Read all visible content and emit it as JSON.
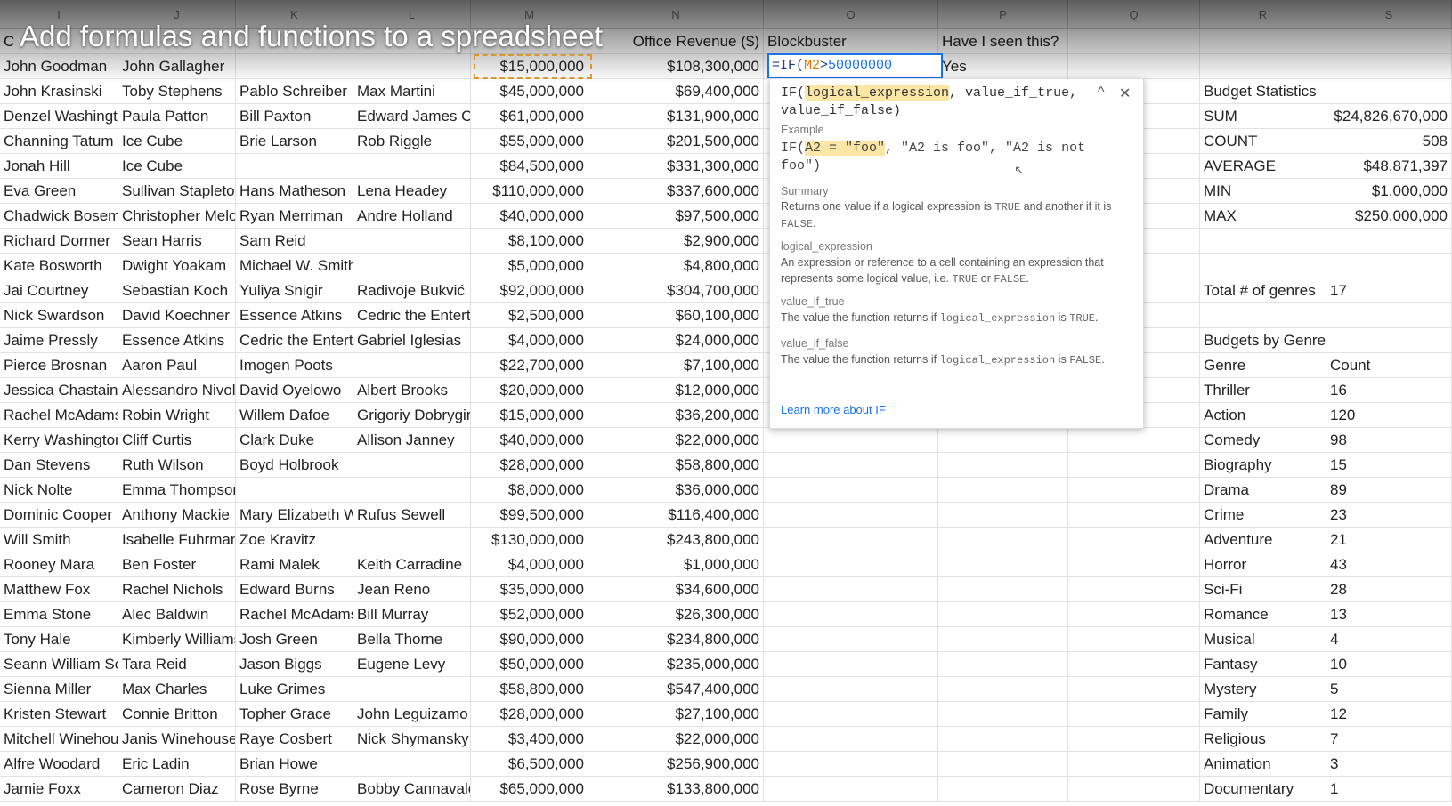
{
  "video_title": "Add formulas and functions to a spreadsheet",
  "column_letters": [
    "I",
    "J",
    "K",
    "L",
    "M",
    "N",
    "O",
    "P",
    "Q",
    "R",
    "S"
  ],
  "header_row": {
    "i": "C",
    "j": "",
    "k": "",
    "l": "",
    "m": "",
    "n": "Office Revenue ($)",
    "o": "Blockbuster",
    "p": "Have I seen this?"
  },
  "active_cell": {
    "formula_prefix": "=IF(",
    "formula_ref": "M2",
    "formula_op": ">",
    "formula_literal": "50000000",
    "p2_value": "Yes"
  },
  "movies": [
    [
      "John Goodman",
      "John Gallagher",
      "",
      "",
      "$15,000,000",
      "$108,300,000"
    ],
    [
      "John Krasinski",
      "Toby Stephens",
      "Pablo Schreiber",
      "Max Martini",
      "$45,000,000",
      "$69,400,000"
    ],
    [
      "Denzel Washingt",
      "Paula Patton",
      "Bill Paxton",
      "Edward James C",
      "$61,000,000",
      "$131,900,000"
    ],
    [
      "Channing Tatum",
      "Ice Cube",
      "Brie Larson",
      "Rob Riggle",
      "$55,000,000",
      "$201,500,000"
    ],
    [
      "Jonah Hill",
      "Ice Cube",
      "",
      "",
      "$84,500,000",
      "$331,300,000"
    ],
    [
      "Eva Green",
      "Sullivan Stapleto",
      "Hans Matheson",
      "Lena Headey",
      "$110,000,000",
      "$337,600,000"
    ],
    [
      "Chadwick Bosem",
      "Christopher Melo",
      "Ryan Merriman",
      "Andre Holland",
      "$40,000,000",
      "$97,500,000"
    ],
    [
      "Richard Dormer",
      "Sean Harris",
      "Sam Reid",
      "",
      "$8,100,000",
      "$2,900,000"
    ],
    [
      "Kate Bosworth",
      "Dwight Yoakam",
      "Michael W. Smith",
      "",
      "$5,000,000",
      "$4,800,000"
    ],
    [
      "Jai Courtney",
      "Sebastian Koch",
      "Yuliya Snigir",
      "Radivoje Bukvić",
      "$92,000,000",
      "$304,700,000"
    ],
    [
      "Nick Swardson",
      "David Koechner",
      "Essence Atkins",
      "Cedric the Entert",
      "$2,500,000",
      "$60,100,000"
    ],
    [
      "Jaime Pressly",
      "Essence Atkins",
      "Cedric the Entert",
      "Gabriel Iglesias",
      "$4,000,000",
      "$24,000,000"
    ],
    [
      "Pierce Brosnan",
      "Aaron Paul",
      "Imogen Poots",
      "",
      "$22,700,000",
      "$7,100,000"
    ],
    [
      "Jessica Chastain",
      "Alessandro Nivol",
      "David Oyelowo",
      "Albert Brooks",
      "$20,000,000",
      "$12,000,000"
    ],
    [
      "Rachel McAdams",
      "Robin Wright",
      "Willem Dafoe",
      "Grigoriy Dobrygir",
      "$15,000,000",
      "$36,200,000"
    ],
    [
      "Kerry Washington",
      "Cliff Curtis",
      "Clark Duke",
      "Allison Janney",
      "$40,000,000",
      "$22,000,000"
    ],
    [
      "Dan Stevens",
      "Ruth Wilson",
      "Boyd Holbrook",
      "",
      "$28,000,000",
      "$58,800,000"
    ],
    [
      "Nick Nolte",
      "Emma Thompson",
      "",
      "",
      "$8,000,000",
      "$36,000,000"
    ],
    [
      "Dominic Cooper",
      "Anthony Mackie",
      "Mary Elizabeth W",
      "Rufus Sewell",
      "$99,500,000",
      "$116,400,000"
    ],
    [
      "Will Smith",
      "Isabelle Fuhrman",
      "Zoe Kravitz",
      "",
      "$130,000,000",
      "$243,800,000"
    ],
    [
      "Rooney Mara",
      "Ben Foster",
      "Rami Malek",
      "Keith Carradine",
      "$4,000,000",
      "$1,000,000"
    ],
    [
      "Matthew Fox",
      "Rachel Nichols",
      "Edward Burns",
      "Jean Reno",
      "$35,000,000",
      "$34,600,000"
    ],
    [
      "Emma Stone",
      "Alec Baldwin",
      "Rachel McAdams",
      "Bill Murray",
      "$52,000,000",
      "$26,300,000"
    ],
    [
      "Tony Hale",
      "Kimberly Williams",
      "Josh Green",
      "Bella Thorne",
      "$90,000,000",
      "$234,800,000"
    ],
    [
      "Seann William Sc",
      "Tara Reid",
      "Jason Biggs",
      "Eugene Levy",
      "$50,000,000",
      "$235,000,000"
    ],
    [
      "Sienna Miller",
      "Max Charles",
      "Luke Grimes",
      "",
      "$58,800,000",
      "$547,400,000"
    ],
    [
      "Kristen Stewart",
      "Connie Britton",
      "Topher Grace",
      "John Leguizamo",
      "$28,000,000",
      "$27,100,000"
    ],
    [
      "Mitchell Winehou",
      "Janis Winehouse",
      "Raye Cosbert",
      "Nick Shymansky",
      "$3,400,000",
      "$22,000,000"
    ],
    [
      "Alfre Woodard",
      "Eric Ladin",
      "Brian Howe",
      "",
      "$6,500,000",
      "$256,900,000"
    ],
    [
      "Jamie Foxx",
      "Cameron Diaz",
      "Rose Byrne",
      "Bobby Cannavale",
      "$65,000,000",
      "$133,800,000"
    ]
  ],
  "stats": {
    "title": "Budget Statistics",
    "rows": [
      {
        "label": "SUM",
        "value": "$24,826,670,000"
      },
      {
        "label": "COUNT",
        "value": "508"
      },
      {
        "label": "AVERAGE",
        "value": "$48,871,397"
      },
      {
        "label": "MIN",
        "value": "$1,000,000"
      },
      {
        "label": "MAX",
        "value": "$250,000,000"
      }
    ],
    "genres_total_label": "Total # of genres",
    "genres_total_value": "17"
  },
  "genres": {
    "title": "Budgets by Genre",
    "col_genre": "Genre",
    "col_count": "Count",
    "rows": [
      {
        "genre": "Thriller",
        "count": "16"
      },
      {
        "genre": "Action",
        "count": "120"
      },
      {
        "genre": "Comedy",
        "count": "98"
      },
      {
        "genre": "Biography",
        "count": "15"
      },
      {
        "genre": "Drama",
        "count": "89"
      },
      {
        "genre": "Crime",
        "count": "23"
      },
      {
        "genre": "Adventure",
        "count": "21"
      },
      {
        "genre": "Horror",
        "count": "43"
      },
      {
        "genre": "Sci-Fi",
        "count": "28"
      },
      {
        "genre": "Romance",
        "count": "13"
      },
      {
        "genre": "Musical",
        "count": "4"
      },
      {
        "genre": "Fantasy",
        "count": "10"
      },
      {
        "genre": "Mystery",
        "count": "5"
      },
      {
        "genre": "Family",
        "count": "12"
      },
      {
        "genre": "Religious",
        "count": "7"
      },
      {
        "genre": "Animation",
        "count": "3"
      },
      {
        "genre": "Documentary",
        "count": "1"
      }
    ]
  },
  "popup": {
    "sig_fn": "IF(",
    "sig_param1": "logical_expression",
    "sig_rest": ", value_if_true, value_if_false)",
    "collapse_glyph": "^",
    "close_glyph": "✕",
    "example_label": "Example",
    "example_prefix": "IF(",
    "example_highlight": "A2 = \"foo\"",
    "example_rest": ", \"A2 is foo\", \"A2 is not foo\")",
    "summary_label": "Summary",
    "summary_a": "Returns one value if a logical expression is ",
    "summary_true": "TRUE",
    "summary_b": " and another if it is ",
    "summary_false": "FALSE",
    "summary_c": ".",
    "p1_name": "logical_expression",
    "p1_a": "An expression or reference to a cell containing an expression that represents some logical value, i.e. ",
    "p1_true": "TRUE",
    "p1_or": " or ",
    "p1_false": "FALSE",
    "p1_end": ".",
    "p2_name": "value_if_true",
    "p2_a": "The value the function returns if ",
    "p2_code": "logical_expression",
    "p2_is": " is ",
    "p2_true": "TRUE",
    "p2_end": ".",
    "p3_name": "value_if_false",
    "p3_a": "The value the function returns if ",
    "p3_code": "logical_expression",
    "p3_is": " is ",
    "p3_false": "FALSE",
    "p3_end": ".",
    "learn_more": "Learn more about IF"
  },
  "colors": {
    "accent": "#1a73e8",
    "formula_ref": "#e37400",
    "selection_dash": "#d99a2b",
    "highlight": "#fbe6a6"
  }
}
